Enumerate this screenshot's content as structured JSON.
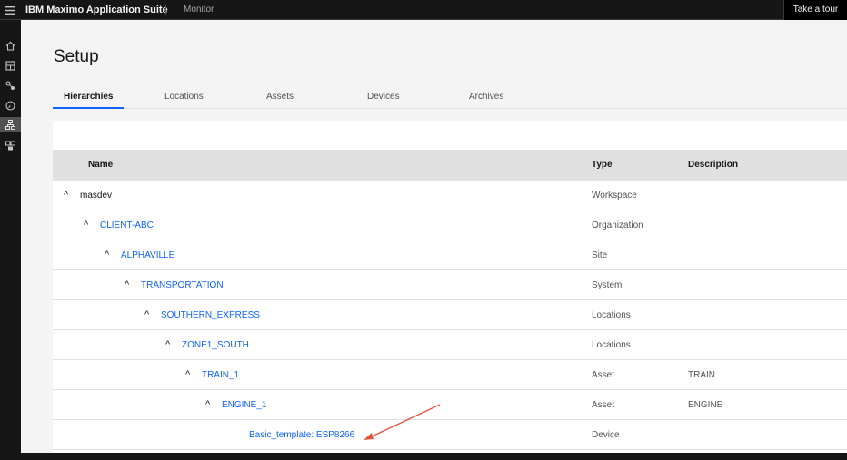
{
  "topbar": {
    "brand": "IBM Maximo Application Suite",
    "app": "Monitor",
    "tour_button": "Take a tour"
  },
  "sidenav": {
    "items": [
      "home-icon",
      "dashboard-icon",
      "connect-icon",
      "gauge-icon",
      "hierarchy-icon",
      "devices-icon"
    ],
    "active": "hierarchy-icon"
  },
  "page": {
    "title": "Setup"
  },
  "tabs": [
    {
      "label": "Hierarchies",
      "active": true
    },
    {
      "label": "Locations",
      "active": false
    },
    {
      "label": "Assets",
      "active": false
    },
    {
      "label": "Devices",
      "active": false
    },
    {
      "label": "Archives",
      "active": false
    }
  ],
  "table": {
    "headers": {
      "name": "Name",
      "type": "Type",
      "description": "Description"
    },
    "rows": [
      {
        "name": "masdev",
        "type": "Workspace",
        "description": "",
        "expanded": true
      },
      {
        "name": "CLIENT-ABC",
        "type": "Organization",
        "description": "",
        "expanded": true
      },
      {
        "name": "ALPHAVILLE",
        "type": "Site",
        "description": "",
        "expanded": true
      },
      {
        "name": "TRANSPORTATION",
        "type": "System",
        "description": "",
        "expanded": true
      },
      {
        "name": "SOUTHERN_EXPRESS",
        "type": "Locations",
        "description": "",
        "expanded": true
      },
      {
        "name": "ZONE1_SOUTH",
        "type": "Locations",
        "description": "",
        "expanded": true
      },
      {
        "name": "TRAIN_1",
        "type": "Asset",
        "description": "TRAIN",
        "expanded": true
      },
      {
        "name": "ENGINE_1",
        "type": "Asset",
        "description": "ENGINE",
        "expanded": true
      },
      {
        "name": "Basic_template: ESP8266",
        "type": "Device",
        "description": "",
        "expanded": false
      }
    ]
  },
  "chevron_glyph": "^",
  "colors": {
    "link": "#0f62fe",
    "annotation_arrow": "#e5533d",
    "shell": "#161616"
  }
}
